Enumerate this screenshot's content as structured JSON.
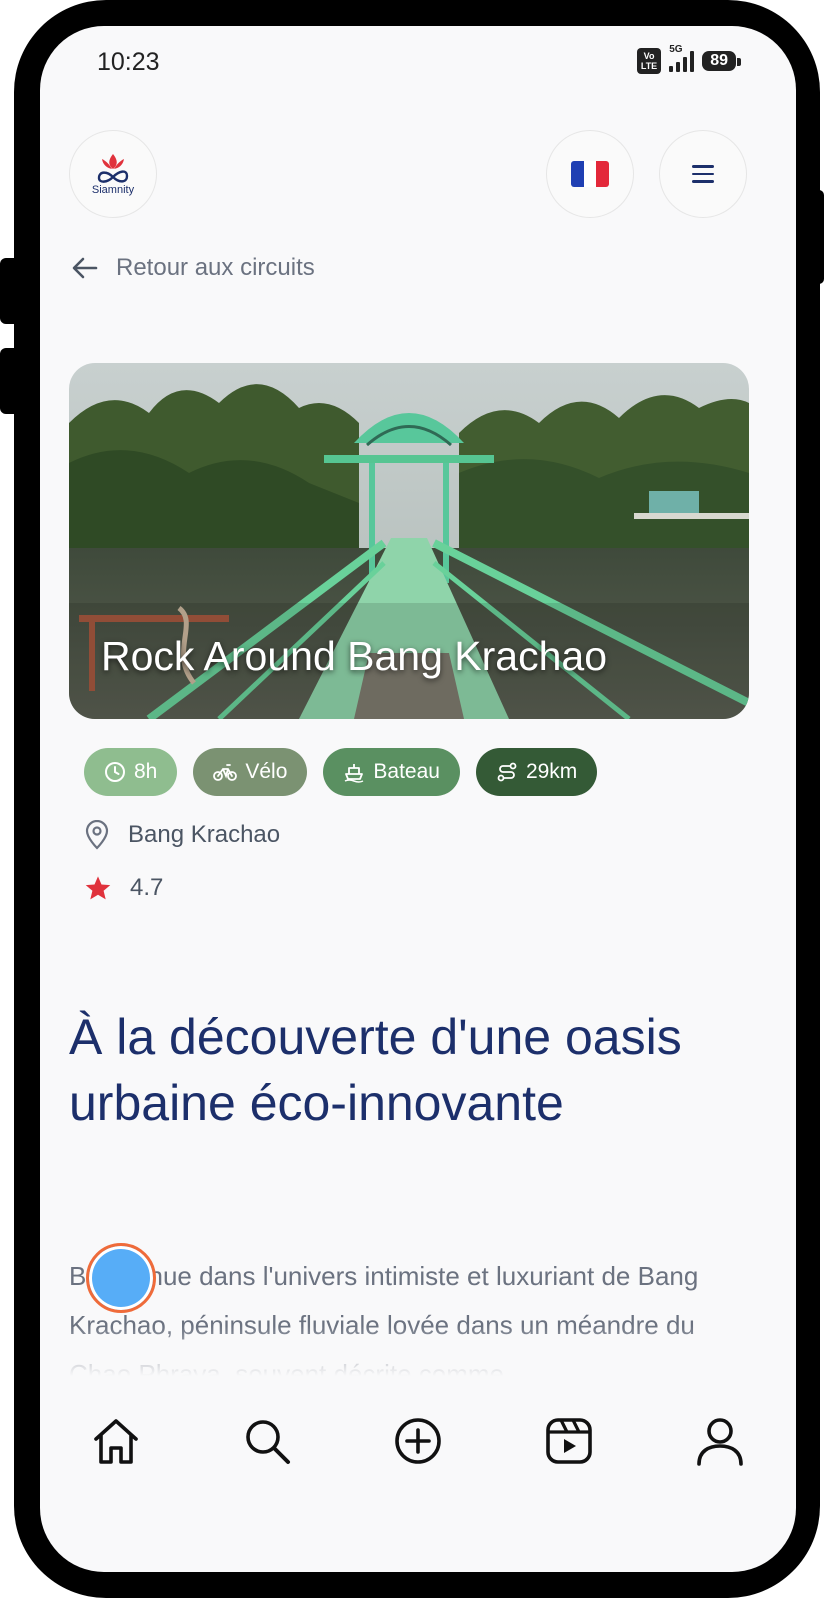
{
  "status_bar": {
    "time": "10:23",
    "network_badge_top": "Vo",
    "network_badge_bottom": "LTE",
    "network_type": "5G",
    "battery": "89"
  },
  "header": {
    "logo_text": "Siamnity",
    "language_flag": "fr",
    "menu_icon": "hamburger-menu-icon"
  },
  "back_link": {
    "label": "Retour aux circuits"
  },
  "tour": {
    "title": "Rock Around Bang Krachao",
    "tags": [
      {
        "icon": "clock-icon",
        "label": "8h",
        "color": "#8fbd8f"
      },
      {
        "icon": "bicycle-icon",
        "label": "Vélo",
        "color": "#7b9272"
      },
      {
        "icon": "boat-icon",
        "label": "Bateau",
        "color": "#5a9061"
      },
      {
        "icon": "route-icon",
        "label": "29km",
        "color": "#345a36"
      }
    ],
    "location": "Bang Krachao",
    "rating": "4.7"
  },
  "content": {
    "heading": "À la découverte d'une oasis urbaine éco-innovante",
    "body": "Bienvenue dans l'univers intimiste et luxuriant de Bang Krachao, péninsule fluviale lovée dans un méandre du Chao Phraya, souvent décrite comme"
  },
  "bottom_nav": [
    "home-icon",
    "search-icon",
    "add-icon",
    "reels-icon",
    "profile-icon"
  ],
  "colors": {
    "brand_navy": "#1c2f6b",
    "star_red": "#e0323c",
    "touch_dot": "#57adf7"
  }
}
